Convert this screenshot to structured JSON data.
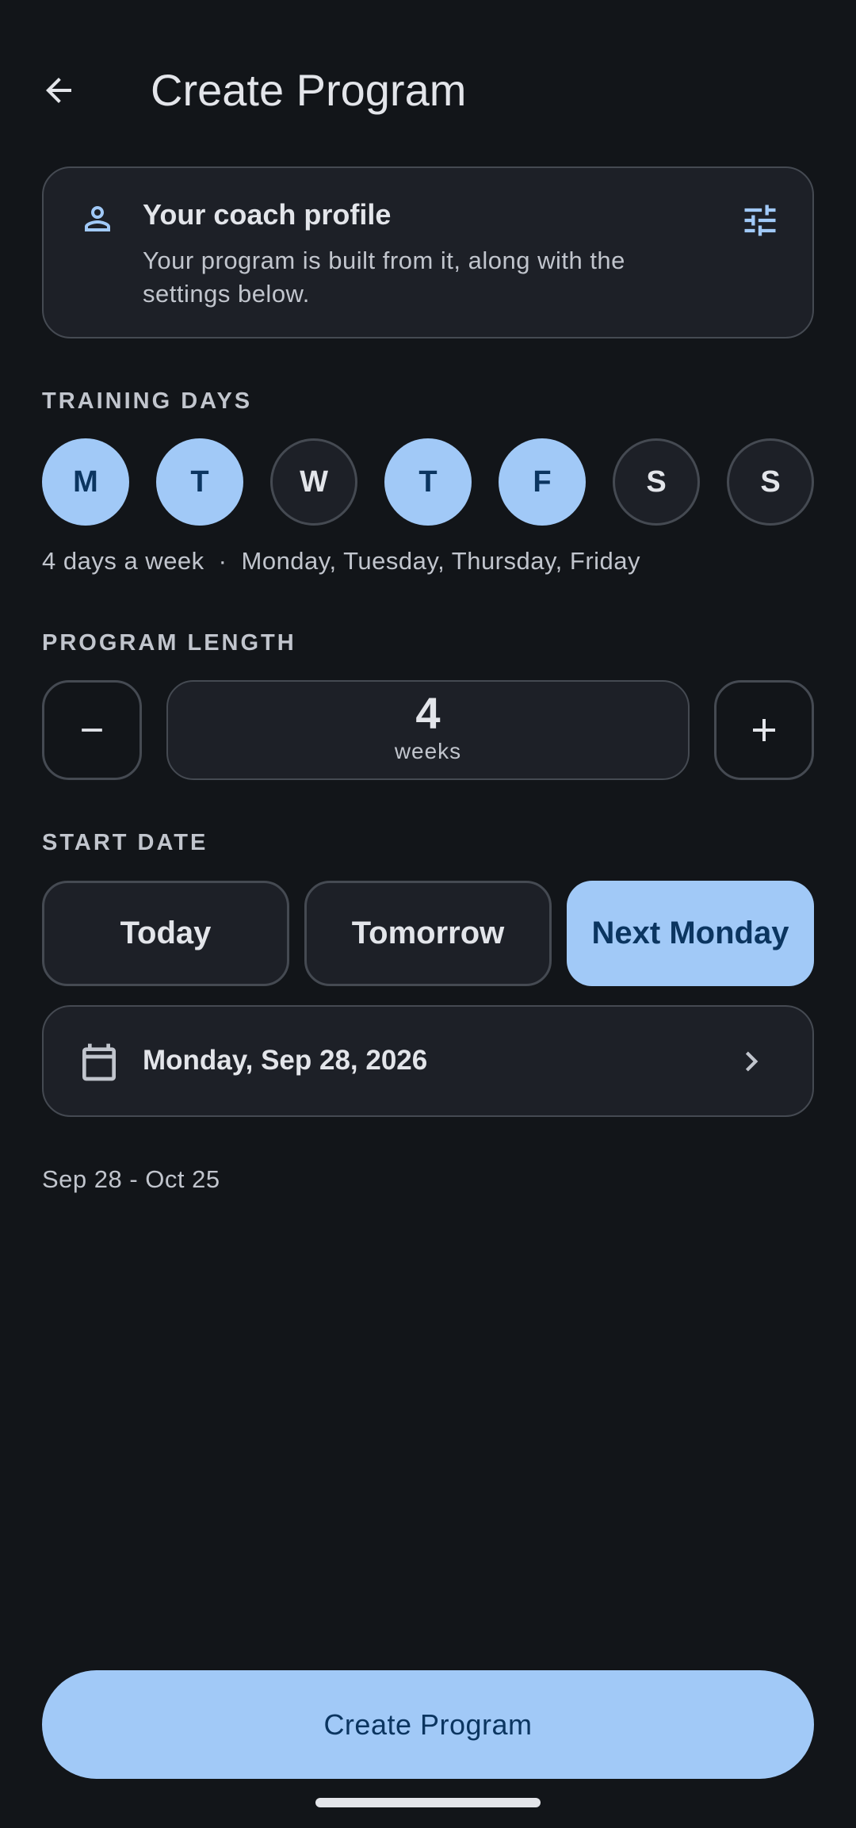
{
  "header": {
    "title": "Create Program",
    "back_icon": "arrow-back-icon"
  },
  "profile_card": {
    "title": "Your coach profile",
    "description": "Your program is built from it, along with the settings below.",
    "icon": "person-icon",
    "action_icon": "tune-icon"
  },
  "training_days": {
    "label": "TRAINING DAYS",
    "days": [
      {
        "letter": "M",
        "selected": true
      },
      {
        "letter": "T",
        "selected": true
      },
      {
        "letter": "W",
        "selected": false
      },
      {
        "letter": "T",
        "selected": true
      },
      {
        "letter": "F",
        "selected": true
      },
      {
        "letter": "S",
        "selected": false
      },
      {
        "letter": "S",
        "selected": false
      }
    ],
    "summary_count": "4 days a week",
    "summary_separator": "·",
    "summary_days": "Monday, Tuesday, Thursday, Friday"
  },
  "program_length": {
    "label": "PROGRAM LENGTH",
    "value": "4",
    "unit": "weeks"
  },
  "start_date": {
    "label": "START DATE",
    "options": [
      {
        "label": "Today",
        "selected": false
      },
      {
        "label": "Tomorrow",
        "selected": false
      },
      {
        "label": "Next Monday",
        "selected": true
      }
    ],
    "selected_date": "Monday, Sep 28, 2026",
    "range": "Sep 28 - Oct 25"
  },
  "footer": {
    "create_label": "Create Program"
  },
  "colors": {
    "background": "#121519",
    "surface": "#1d2027",
    "accent": "#a1c9f7",
    "on_accent": "#0b3560",
    "outline": "#454a52"
  }
}
